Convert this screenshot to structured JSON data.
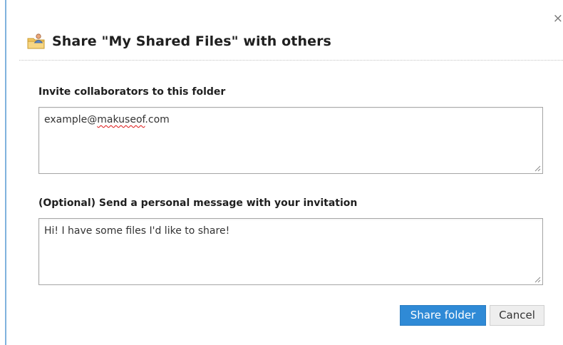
{
  "dialog": {
    "title": "Share \"My Shared Files\" with others",
    "close_label": "×",
    "title_icon": "folder-person-icon"
  },
  "invite": {
    "label": "Invite collaborators to this folder",
    "value_prefix": "example@",
    "value_misspelled": "makuseof",
    "value_suffix": ".com"
  },
  "message": {
    "label": "(Optional) Send a personal message with your invitation",
    "value": "Hi! I have some files I'd like to share!"
  },
  "actions": {
    "share_label": "Share folder",
    "cancel_label": "Cancel"
  },
  "colors": {
    "primary": "#2f8ad6",
    "left_rule": "#7fb2de"
  }
}
